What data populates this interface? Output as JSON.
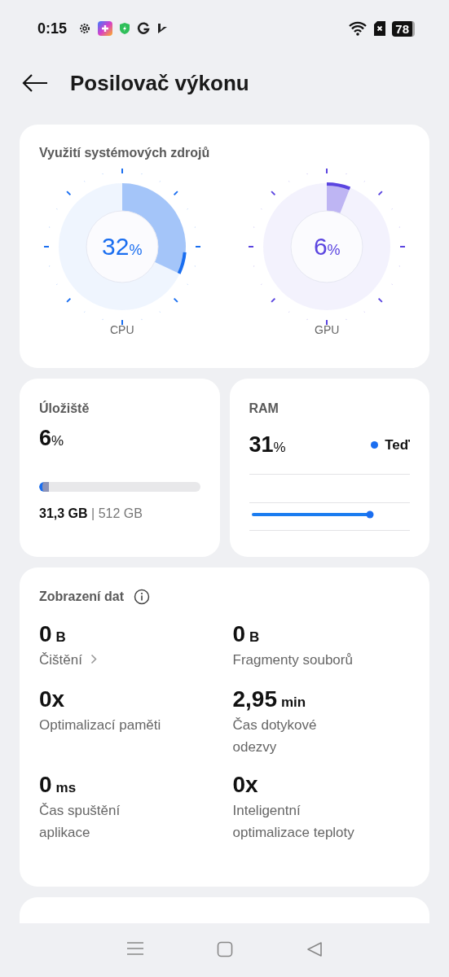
{
  "status_bar": {
    "time": "0:15",
    "battery": "78"
  },
  "header": {
    "title": "Posilovač výkonu"
  },
  "usage": {
    "title": "Využití systémových zdrojů",
    "gauges": [
      {
        "label": "CPU",
        "value": "32",
        "unit": "%",
        "color": "#1a6ef0"
      },
      {
        "label": "GPU",
        "value": "6",
        "unit": "%",
        "color": "#5b45e0"
      }
    ]
  },
  "storage": {
    "title": "Úložiště",
    "value": "6",
    "unit": "%",
    "level": 0.06,
    "usage": "**31,3 GB** | 512 GB"
  },
  "ram": {
    "title": "RAM",
    "value": "31",
    "unit": "%",
    "legend": "Teď"
  },
  "data_view": {
    "title": "Zobrazení dat",
    "stats": [
      {
        "kind": "link",
        "value": "0",
        "unit": "B",
        "label": "Čištění"
      },
      {
        "kind": "plain",
        "value": "0",
        "unit": "B",
        "label": "Fragmenty souborů"
      },
      {
        "kind": "plain",
        "value": "0x",
        "label": "Optimalizací paměti"
      },
      {
        "kind": "plain",
        "value": "2,95",
        "unit": "min",
        "label": "Čas dotykové odezvy"
      },
      {
        "kind": "plain",
        "value": "0",
        "unit": "ms",
        "label": "Čas spuštění aplikace"
      },
      {
        "kind": "plain",
        "value": "0x",
        "label": "Inteligentní optimalizace teploty"
      }
    ]
  }
}
